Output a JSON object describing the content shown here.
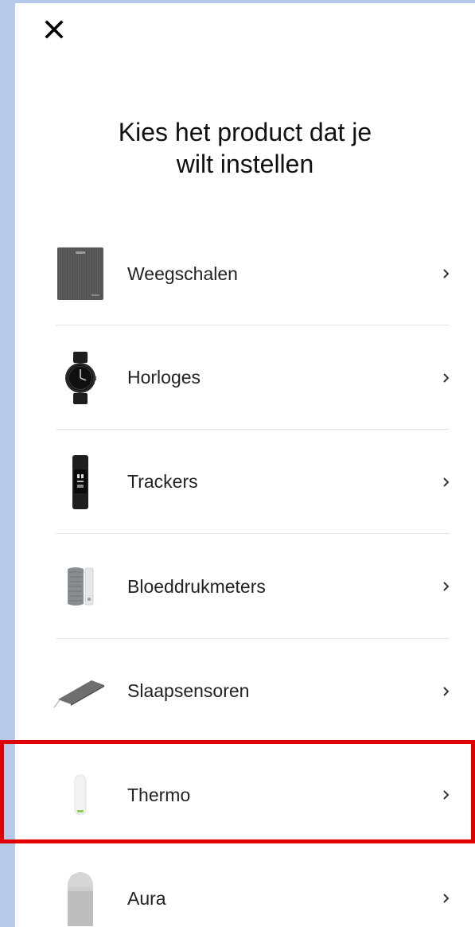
{
  "header": {
    "close_icon": "close-icon",
    "title_line1": "Kies het product dat je",
    "title_line2": "wilt instellen"
  },
  "products": [
    {
      "label": "Weegschalen",
      "icon": "scale-icon"
    },
    {
      "label": "Horloges",
      "icon": "watch-icon"
    },
    {
      "label": "Trackers",
      "icon": "tracker-icon"
    },
    {
      "label": "Bloeddrukmeters",
      "icon": "blood-pressure-monitor-icon"
    },
    {
      "label": "Slaapsensoren",
      "icon": "sleep-sensor-icon"
    },
    {
      "label": "Thermo",
      "icon": "thermometer-icon",
      "highlighted": true
    },
    {
      "label": "Aura",
      "icon": "aura-icon"
    }
  ],
  "colors": {
    "background": "#b5c9e8",
    "sheet": "#ffffff",
    "highlight": "#e00000",
    "divider": "#e3e3e3"
  }
}
